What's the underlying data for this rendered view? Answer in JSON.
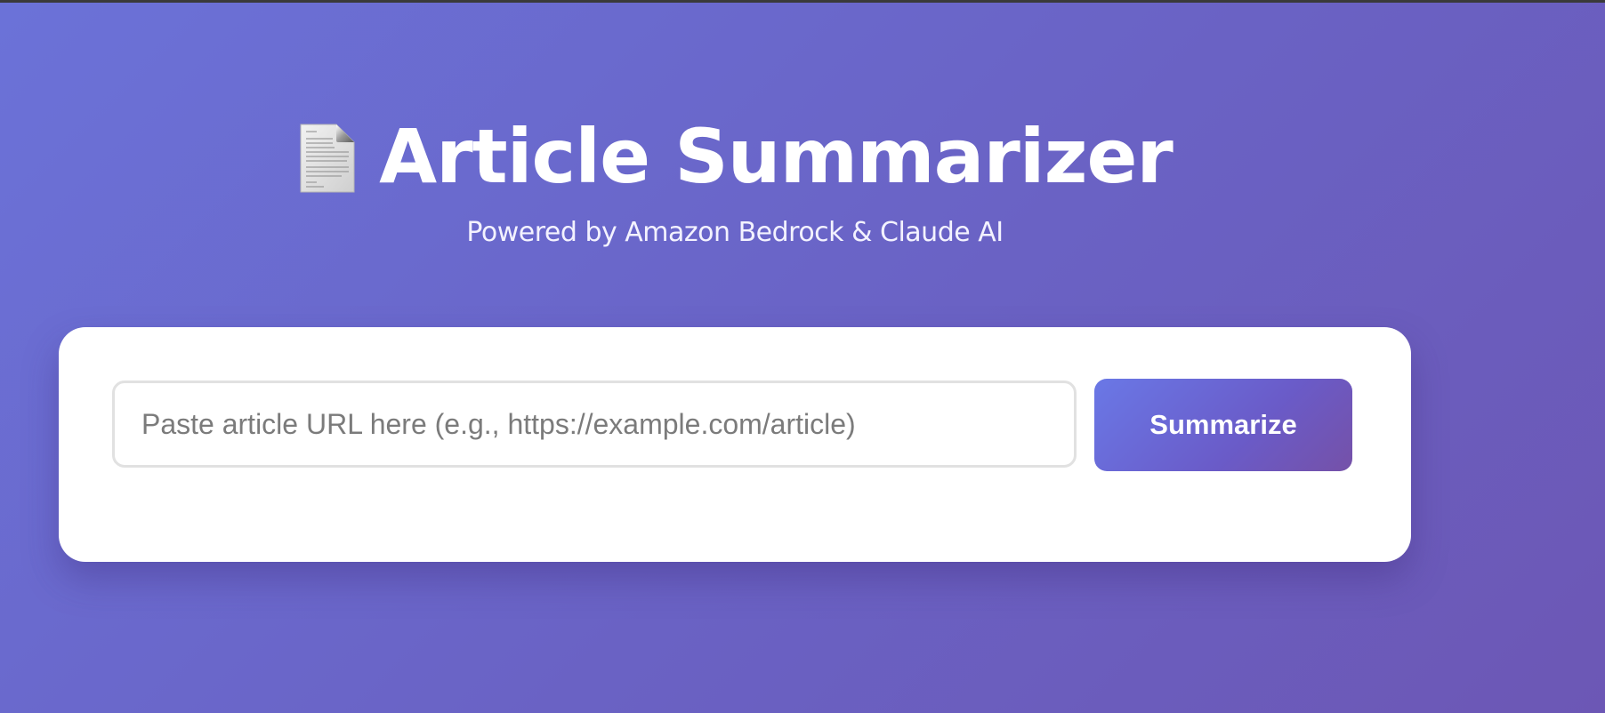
{
  "header": {
    "icon": "page-facing-up-icon",
    "title": "Article Summarizer",
    "subtitle": "Powered by Amazon Bedrock & Claude AI"
  },
  "form": {
    "url_placeholder": "Paste article URL here (e.g., https://example.com/article)",
    "url_value": "",
    "submit_label": "Summarize"
  },
  "colors": {
    "background_start": "#6b72d8",
    "background_end": "#6c57b5",
    "button_start": "#6a78e6",
    "button_end": "#7551a8",
    "card": "#ffffff"
  }
}
